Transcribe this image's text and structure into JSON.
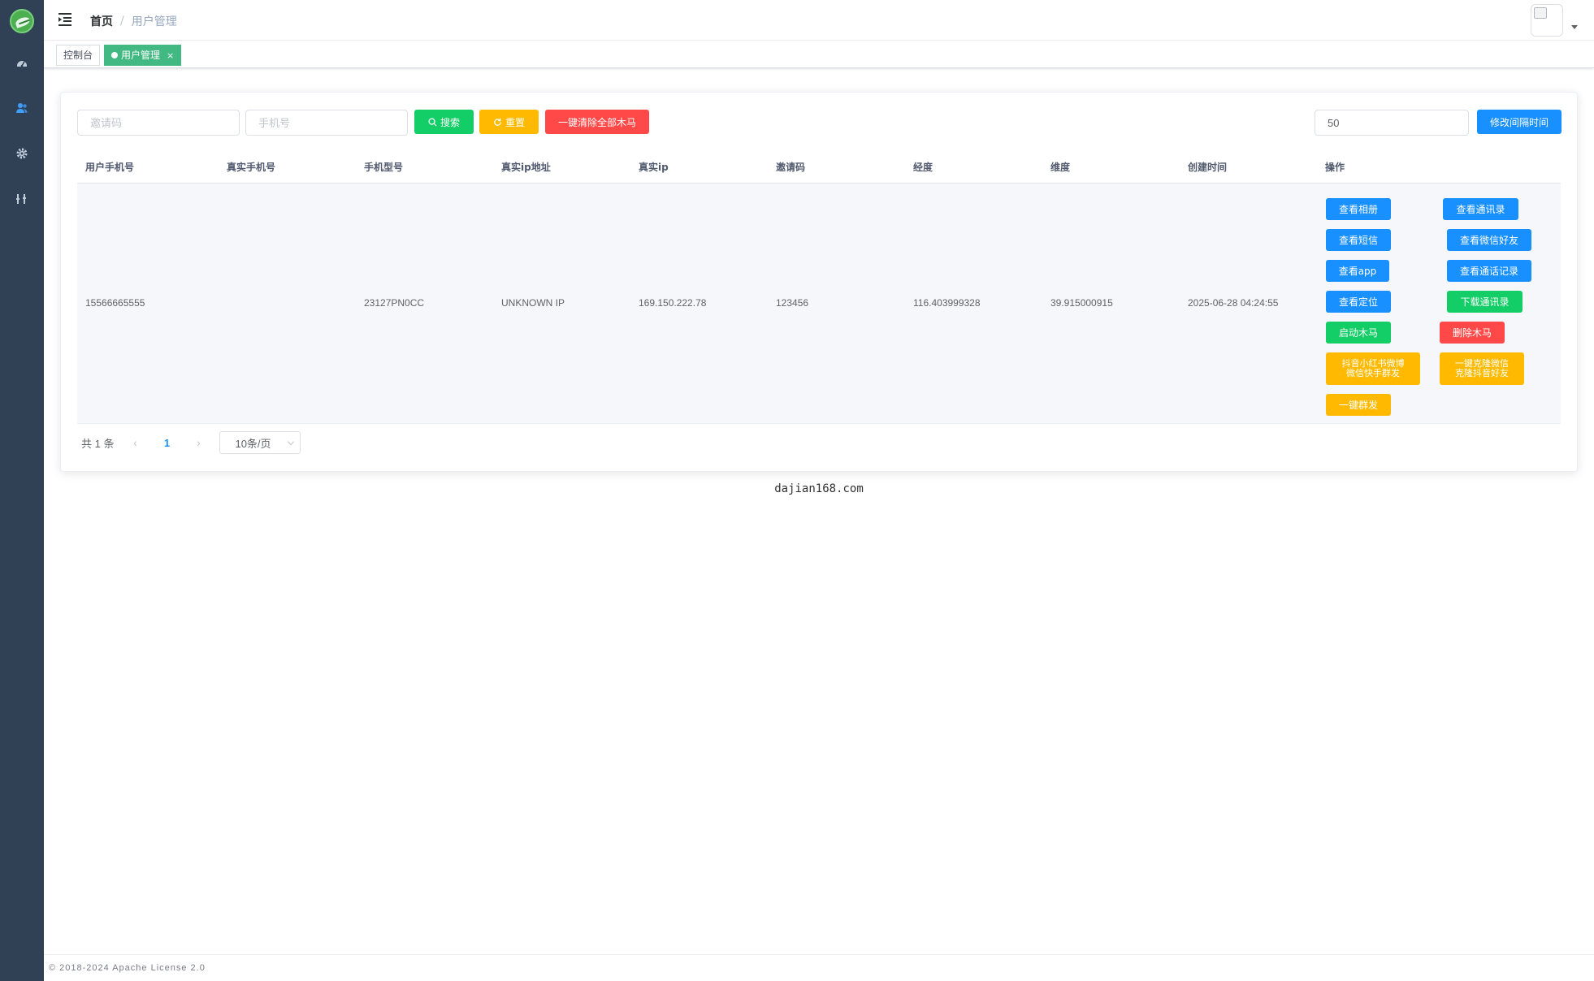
{
  "breadcrumb": {
    "home": "首页",
    "separator": "/",
    "current": "用户管理"
  },
  "tags": [
    {
      "label": "控制台",
      "active": false
    },
    {
      "label": "用户管理",
      "active": true,
      "close": "×"
    }
  ],
  "search": {
    "invite_placeholder": "邀请码",
    "phone_placeholder": "手机号",
    "search_label": "搜索",
    "reset_label": "重置",
    "clear_all_label": "一键清除全部木马",
    "interval_value": "50",
    "interval_button": "修改间隔时间"
  },
  "table": {
    "headers": [
      "用户手机号",
      "真实手机号",
      "手机型号",
      "真实ip地址",
      "真实ip",
      "邀请码",
      "经度",
      "维度",
      "创建时间",
      "操作"
    ],
    "rows": [
      {
        "phone": "15566665555",
        "real_phone": "",
        "model": "23127PN0CC",
        "ip_address": "UNKNOWN IP",
        "real_ip": "169.150.222.78",
        "invite_code": "123456",
        "longitude": "116.403999328",
        "latitude": "39.915000915",
        "created": "2025-06-28 04:24:55"
      }
    ],
    "actions": {
      "view_album": "查看相册",
      "view_contacts": "查看通讯录",
      "view_sms": "查看短信",
      "view_wechat_friends": "查看微信好友",
      "view_app": "查看app",
      "view_call_log": "查看通话记录",
      "view_location": "查看定位",
      "download_contacts": "下载通讯录",
      "start_trojan": "启动木马",
      "delete_trojan": "删除木马",
      "mass_send_social_line1": "抖音小红书微博",
      "mass_send_social_line2": "微信快手群发",
      "clone_friends_line1": "一键克隆微信",
      "clone_friends_line2": "克隆抖音好友",
      "mass_send": "一键群发"
    }
  },
  "pagination": {
    "total": "共 1 条",
    "prev": "‹",
    "page": "1",
    "next": "›",
    "page_size": "10条/页"
  },
  "watermark": "dajian168.com",
  "footer": "© 2018-2024 Apache License 2.0",
  "colors": {
    "sidebar": "#304156",
    "tag_active": "#42b983",
    "green": "#13ce66",
    "orange": "#ffba00",
    "red": "#ff4949",
    "blue": "#1890ff"
  }
}
